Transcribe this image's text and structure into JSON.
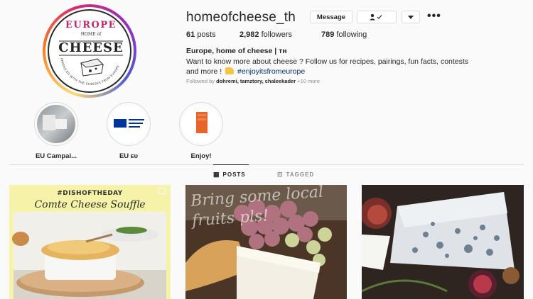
{
  "profile": {
    "username": "homeofcheese_th",
    "logo_text": {
      "top": "EUROPE",
      "middle": "HOME of",
      "main": "CHEESE",
      "ring": "PRODUCED WITH THE CHEESES FROM EUROPE"
    },
    "buttons": {
      "message": "Message",
      "follow_icon": "person-check-icon",
      "dropdown_icon": "chevron-down-icon",
      "more_icon": "ellipsis-icon"
    },
    "stats": {
      "posts_count": "61",
      "posts_label": "posts",
      "followers_count": "2,982",
      "followers_label": "followers",
      "following_count": "789",
      "following_label": "following"
    },
    "full_name": "Europe, home of cheese | ᴛʜ",
    "bio_line1": "Want to know more about cheese ? Follow us for recipes, pairings, fun facts, contests",
    "bio_line2_pre": "and more !",
    "bio_hashtag": "#enjoyitsfromeurope",
    "followed_prefix": "Followed by",
    "followed_names": "dohremi, tamztory, chaleekader",
    "followed_more": "+10 more"
  },
  "highlights": [
    {
      "label": "EU Campai..."
    },
    {
      "label": "EU ᴇᴜ"
    },
    {
      "label": "Enjoy!"
    }
  ],
  "tabs": [
    {
      "label": "POSTS",
      "icon": "grid-icon",
      "active": true
    },
    {
      "label": "TAGGED",
      "icon": "tag-icon",
      "active": false
    }
  ],
  "posts": [
    {
      "tag": "#DISHOFTHEDAY",
      "title": "Comte Cheese Souffle"
    },
    {
      "overlay_line1": "Bring some local",
      "overlay_line2": "fruits pls!"
    },
    {}
  ],
  "colors": {
    "accent_link": "#00376b",
    "muted": "#8e8e8e",
    "border": "#dbdbdb"
  }
}
